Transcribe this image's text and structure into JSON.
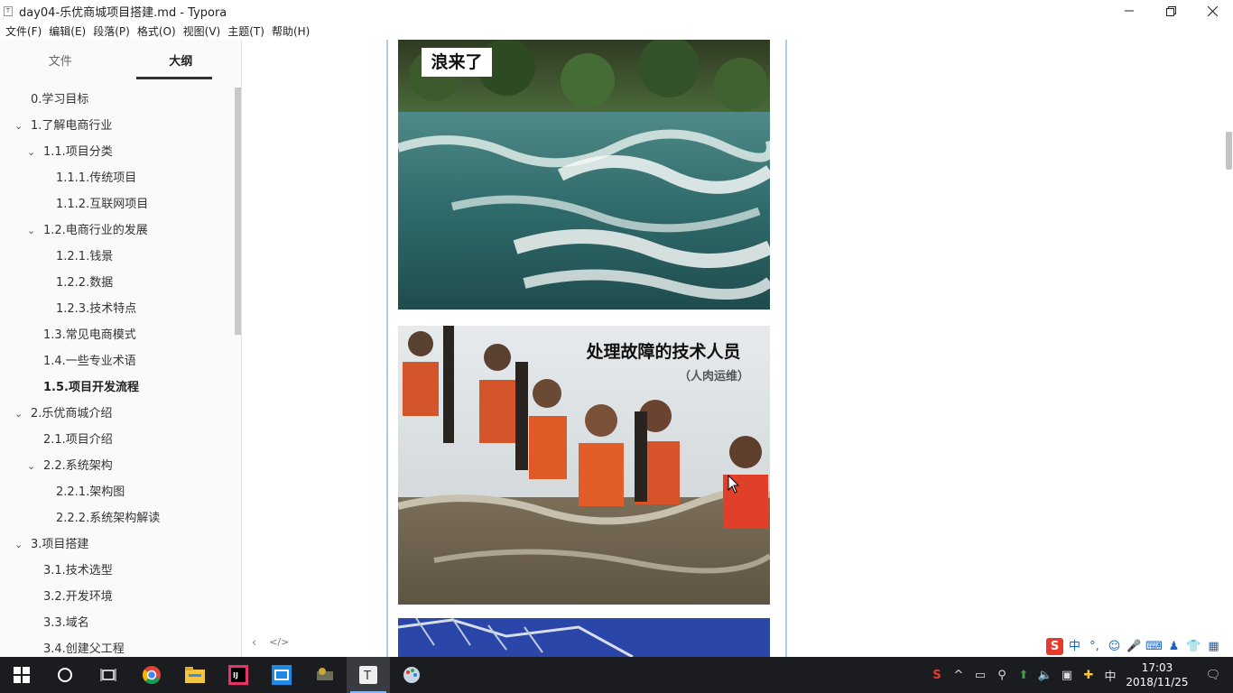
{
  "window": {
    "app_icon": "T",
    "title": "day04-乐优商城项目搭建.md - Typora",
    "minimize_icon": "minimize-icon",
    "restore_icon": "restore-icon",
    "close_icon": "close-icon"
  },
  "menu": [
    "文件(F)",
    "编辑(E)",
    "段落(P)",
    "格式(O)",
    "视图(V)",
    "主题(T)",
    "帮助(H)"
  ],
  "sidebar": {
    "tabs": [
      {
        "label": "文件"
      },
      {
        "label": "大纲"
      }
    ],
    "active_tab": "大纲",
    "outline": [
      {
        "label": "0.学习目标",
        "level": 1,
        "chevron": false
      },
      {
        "label": "1.了解电商行业",
        "level": 1,
        "chevron": true
      },
      {
        "label": "1.1.项目分类",
        "level": 2,
        "chevron": true
      },
      {
        "label": "1.1.1.传统项目",
        "level": 3,
        "chevron": false
      },
      {
        "label": "1.1.2.互联网项目",
        "level": 3,
        "chevron": false
      },
      {
        "label": "1.2.电商行业的发展",
        "level": 2,
        "chevron": true
      },
      {
        "label": "1.2.1.钱景",
        "level": 3,
        "chevron": false
      },
      {
        "label": "1.2.2.数据",
        "level": 3,
        "chevron": false
      },
      {
        "label": "1.2.3.技术特点",
        "level": 3,
        "chevron": false
      },
      {
        "label": "1.3.常见电商模式",
        "level": 2,
        "chevron": false
      },
      {
        "label": "1.4.一些专业术语",
        "level": 2,
        "chevron": false
      },
      {
        "label": "1.5.项目开发流程",
        "level": 2,
        "chevron": false,
        "active": true
      },
      {
        "label": "2.乐优商城介绍",
        "level": 1,
        "chevron": true
      },
      {
        "label": "2.1.项目介绍",
        "level": 2,
        "chevron": false
      },
      {
        "label": "2.2.系统架构",
        "level": 2,
        "chevron": true
      },
      {
        "label": "2.2.1.架构图",
        "level": 3,
        "chevron": false
      },
      {
        "label": "2.2.2.系统架构解读",
        "level": 3,
        "chevron": false
      },
      {
        "label": "3.项目搭建",
        "level": 1,
        "chevron": true
      },
      {
        "label": "3.1.技术选型",
        "level": 2,
        "chevron": false
      },
      {
        "label": "3.2.开发环境",
        "level": 2,
        "chevron": false
      },
      {
        "label": "3.3.域名",
        "level": 2,
        "chevron": false
      },
      {
        "label": "3.4.创建父工程",
        "level": 2,
        "chevron": false
      }
    ]
  },
  "editor": {
    "image1_caption": "浪来了",
    "image2_title": "处理故障的技术人员",
    "image2_subtitle": "（人肉运维）",
    "prev_icon": "chevron-left-icon",
    "source_icon": "code-icon",
    "prev_glyph": "‹",
    "source_glyph": "</>"
  },
  "ime": {
    "lang": "中",
    "punct": "°,"
  },
  "taskbar": {
    "apps": [
      "start-icon",
      "cortana-icon",
      "task-view-icon",
      "chrome-icon",
      "explorer-icon",
      "intellij-icon",
      "app-icon",
      "tool-icon",
      "typora-icon",
      "paint-icon"
    ],
    "active_app": "typora-icon",
    "tray_lang": "中",
    "time": "17:03",
    "date": "2018/11/25"
  },
  "colors": {
    "accent_blue": "#1a6fd4",
    "taskbar_bg": "#1b1c20",
    "sidebar_bg": "#fafafa",
    "doc_border": "#aecbe8"
  }
}
